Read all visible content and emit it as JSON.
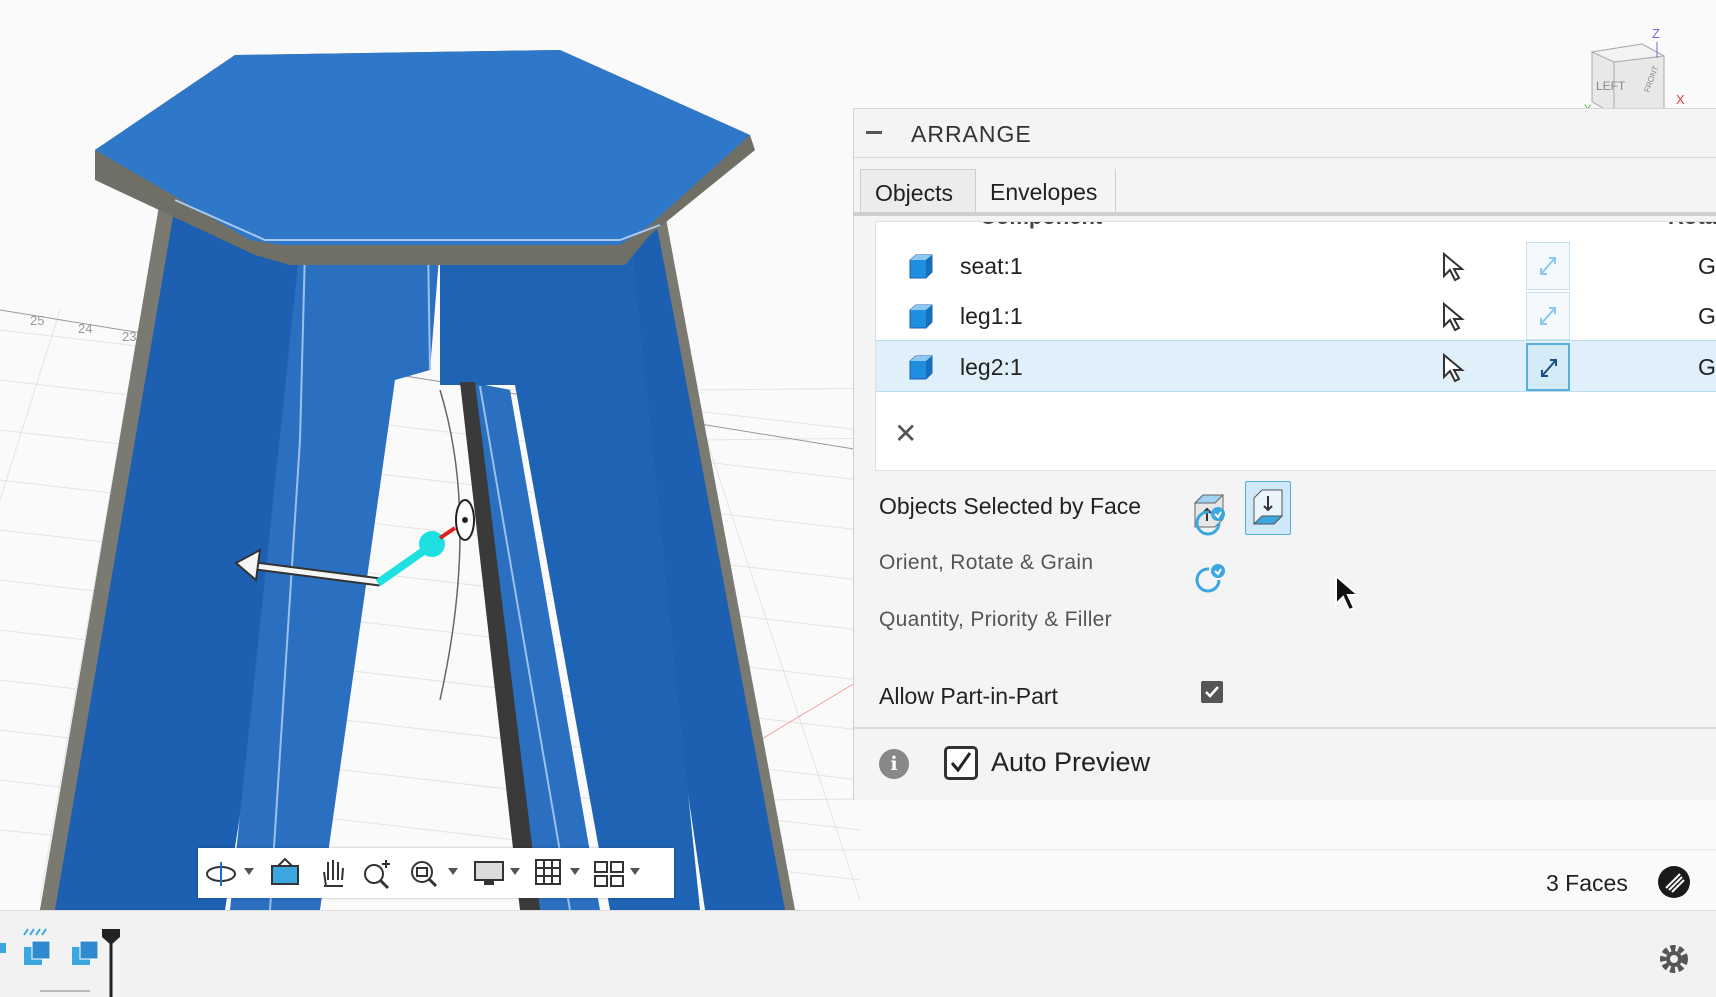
{
  "viewport": {
    "view_cube": {
      "left_label": "LEFT",
      "front_label": "FRONT",
      "z_axis": "Z",
      "x_axis": "X",
      "y_axis": "Y"
    },
    "ruler_ticks": [
      "25",
      "24",
      "23"
    ],
    "selection_info": "3 Faces"
  },
  "arrange_panel": {
    "title": "ARRANGE",
    "tabs": [
      {
        "label": "Objects",
        "active": true
      },
      {
        "label": "Envelopes",
        "active": false
      }
    ],
    "table": {
      "header_component": "Component",
      "header_rotation": "Rotat",
      "rows": [
        {
          "name": "seat:1",
          "trail": "G",
          "selected": false
        },
        {
          "name": "leg1:1",
          "trail": "G",
          "selected": false
        },
        {
          "name": "leg2:1",
          "trail": "G",
          "selected": true
        }
      ],
      "clear_label": "✕"
    },
    "options": {
      "objects_selected_by_face": "Objects Selected by Face",
      "orient_rotate_grain": "Orient, Rotate & Grain",
      "quantity_priority_filler": "Quantity, Priority & Filler",
      "allow_part_in_part": "Allow Part-in-Part",
      "allow_part_in_part_checked": true
    },
    "footer": {
      "info_symbol": "i",
      "auto_preview_label": "Auto Preview",
      "auto_preview_checked": true
    }
  },
  "colors": {
    "model_blue": "#2a6fc0",
    "accent_blue": "#3aa7e0",
    "manipulator_cyan": "#1ee0e0"
  },
  "navigation_toolbar": [
    "orbit-icon",
    "look-at-icon",
    "pan-icon",
    "zoom-icon",
    "fit-icon",
    "display-settings-icon",
    "grid-icon",
    "viewports-icon"
  ]
}
